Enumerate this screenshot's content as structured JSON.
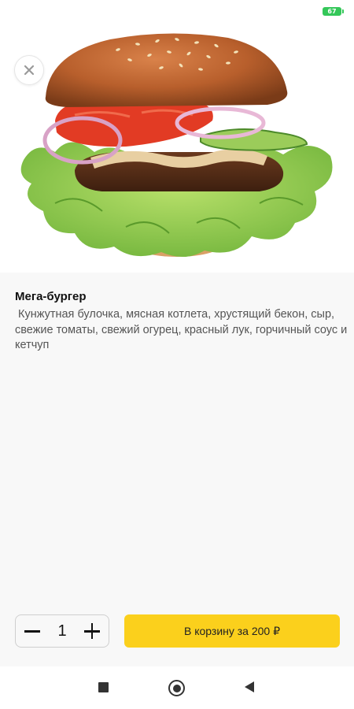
{
  "status_bar": {
    "battery_level": "67"
  },
  "product": {
    "name": "Мега-бургер",
    "description": " Кунжутная булочка, мясная котлета, хрустящий бекон, сыр, свежие томаты, свежий огурец, красный лук, горчичный соус и кетчуп"
  },
  "cart": {
    "quantity": "1",
    "add_button_label": "В корзину за 200 ₽"
  },
  "icons": {
    "close": "close-icon",
    "minus": "minus-icon",
    "plus": "plus-icon",
    "nav_recents": "square-icon",
    "nav_home": "circle-icon",
    "nav_back": "triangle-back-icon"
  },
  "colors": {
    "accent": "#fbd01c",
    "panel_background": "#f8f8f8",
    "battery": "#34c759"
  }
}
